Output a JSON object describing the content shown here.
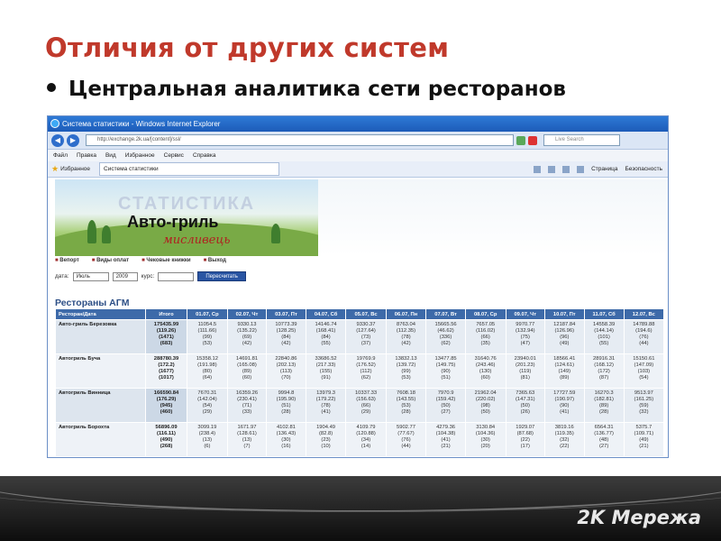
{
  "slide": {
    "title": "Отличия от других систем",
    "bullet": "Центральная аналитика сети ресторанов",
    "footer_logo": "2K Мережа"
  },
  "browser": {
    "window_title": "Система статистики - Windows Internet Explorer",
    "address": "http://exchange.2k.ua/[content]/ssl/",
    "search_placeholder": "Live Search",
    "menu": [
      "Файл",
      "Правка",
      "Вид",
      "Избранное",
      "Сервис",
      "Справка"
    ],
    "favorites_label": "Избранное",
    "tab_label": "Система статистики",
    "toolbar_page": "Страница",
    "toolbar_security": "Безопасность"
  },
  "page": {
    "banner_stat": "СТАТИСТИКА",
    "banner_brand": "Авто-гриль",
    "banner_brand2": "мисливець",
    "nav": [
      "Вепорт",
      "Виды оплат",
      "Чековые книжки",
      "Выход"
    ],
    "filter": {
      "date_label": "дата:",
      "month": "Июль",
      "year": "2009",
      "course_label": "курс:",
      "button": "Пересчитать"
    },
    "section_title": "Рестораны АГМ",
    "columns": [
      "Ресторан/Дата",
      "Итого",
      "01.07, Ср",
      "02.07, Чт",
      "03.07, Пт",
      "04.07, Сб",
      "05.07, Вс",
      "06.07, Пн",
      "07.07, Вт",
      "08.07, Ср",
      "09.07, Чт",
      "10.07, Пт",
      "11.07, Сб",
      "12.07, Вс"
    ],
    "rows": [
      {
        "name": "Авто-гриль Березовка",
        "total": [
          "175435.99",
          "(119.26)",
          "(1471)",
          "(683)"
        ],
        "cells": [
          [
            "11054.5",
            "(111.66)",
            "(99)",
            "(53)"
          ],
          [
            "9330.13",
            "(135.22)",
            "(69)",
            "(42)"
          ],
          [
            "10773.39",
            "(128.25)",
            "(84)",
            "(42)"
          ],
          [
            "14146.74",
            "(168.41)",
            "(84)",
            "(55)"
          ],
          [
            "9330.37",
            "(127.64)",
            "(73)",
            "(37)"
          ],
          [
            "8763.04",
            "(112.35)",
            "(78)",
            "(42)"
          ],
          [
            "15665.56",
            "(46.62)",
            "(336)",
            "(62)"
          ],
          [
            "7657.05",
            "(116.02)",
            "(66)",
            "(35)"
          ],
          [
            "9970.77",
            "(132.94)",
            "(75)",
            "(47)"
          ],
          [
            "12187.84",
            "(126.96)",
            "(96)",
            "(49)"
          ],
          [
            "14558.39",
            "(144.14)",
            "(101)",
            "(55)"
          ],
          [
            "14789.88",
            "(194.6)",
            "(76)",
            "(44)"
          ]
        ]
      },
      {
        "name": "Автогриль Буча",
        "total": [
          "288780.39",
          "(172.2)",
          "(1677)",
          "(1017)"
        ],
        "cells": [
          [
            "15358.12",
            "(191.98)",
            "(80)",
            "(64)"
          ],
          [
            "14691.81",
            "(165.08)",
            "(89)",
            "(60)"
          ],
          [
            "22840.86",
            "(202.13)",
            "(113)",
            "(70)"
          ],
          [
            "33686.52",
            "(217.33)",
            "(155)",
            "(91)"
          ],
          [
            "19769.9",
            "(176.52)",
            "(112)",
            "(62)"
          ],
          [
            "13832.13",
            "(139.72)",
            "(99)",
            "(53)"
          ],
          [
            "13477.85",
            "(149.75)",
            "(90)",
            "(51)"
          ],
          [
            "31640.76",
            "(243.46)",
            "(130)",
            "(60)"
          ],
          [
            "23940.01",
            "(201.23)",
            "(119)",
            "(81)"
          ],
          [
            "18566.41",
            "(124.61)",
            "(149)",
            "(89)"
          ],
          [
            "28916.31",
            "(168.12)",
            "(172)",
            "(87)"
          ],
          [
            "15150.61",
            "(147.09)",
            "(103)",
            "(54)"
          ]
        ]
      },
      {
        "name": "Автогриль Винница",
        "total": [
          "166590.84",
          "(176.29)",
          "(945)",
          "(460)"
        ],
        "cells": [
          [
            "7670.31",
            "(142.04)",
            "(54)",
            "(29)"
          ],
          [
            "16359.26",
            "(230.41)",
            "(71)",
            "(33)"
          ],
          [
            "9994.8",
            "(195.90)",
            "(51)",
            "(28)"
          ],
          [
            "13979.3",
            "(179.22)",
            "(78)",
            "(41)"
          ],
          [
            "10337.33",
            "(156.63)",
            "(66)",
            "(29)"
          ],
          [
            "7608.18",
            "(143.55)",
            "(53)",
            "(28)"
          ],
          [
            "7970.9",
            "(159.42)",
            "(50)",
            "(27)"
          ],
          [
            "21962.04",
            "(220.02)",
            "(98)",
            "(50)"
          ],
          [
            "7365.63",
            "(147.31)",
            "(50)",
            "(26)"
          ],
          [
            "17727.59",
            "(190.97)",
            "(90)",
            "(41)"
          ],
          [
            "16270.3",
            "(182.81)",
            "(89)",
            "(28)"
          ],
          [
            "9513.97",
            "(161.25)",
            "(59)",
            "(32)"
          ]
        ]
      },
      {
        "name": "Автогриль Борохта",
        "total": [
          "56896.09",
          "(116.11)",
          "(490)",
          "(268)"
        ],
        "cells": [
          [
            "3099.19",
            "(238.4)",
            "(13)",
            "(6)"
          ],
          [
            "1671.97",
            "(128.61)",
            "(13)",
            "(7)"
          ],
          [
            "4102.81",
            "(136.43)",
            "(30)",
            "(16)"
          ],
          [
            "1904.49",
            "(82.8)",
            "(23)",
            "(10)"
          ],
          [
            "4109.79",
            "(120.88)",
            "(34)",
            "(14)"
          ],
          [
            "5902.77",
            "(77.67)",
            "(76)",
            "(44)"
          ],
          [
            "4279.36",
            "(104.38)",
            "(41)",
            "(21)"
          ],
          [
            "3130.84",
            "(104.36)",
            "(30)",
            "(20)"
          ],
          [
            "1929.07",
            "(87.68)",
            "(22)",
            "(17)"
          ],
          [
            "3819.16",
            "(119.35)",
            "(32)",
            "(22)"
          ],
          [
            "6564.31",
            "(136.77)",
            "(48)",
            "(27)"
          ],
          [
            "5375.7",
            "(109.71)",
            "(49)",
            "(21)"
          ]
        ]
      }
    ]
  }
}
